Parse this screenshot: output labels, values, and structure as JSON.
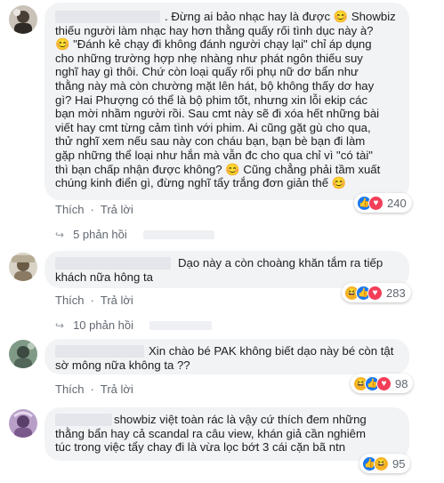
{
  "colors": {
    "like": "#1877f2",
    "love": "#f33e58",
    "haha": "#f7b125",
    "bubble": "#f2f3f5",
    "meta": "#606770"
  },
  "labels": {
    "like": "Thích",
    "reply": "Trả lời",
    "dot": "·"
  },
  "comments": [
    {
      "text": ". Đừng ai bảo nhạc hay là được 😊 Showbiz\nthiếu người làm nhạc hay hơn thằng quấy rối tình dục này à?\n😊 \"Đánh kẻ chạy đi không đánh người chạy lại\" chỉ áp dụng\ncho những trường hợp nhẹ nhàng như phát ngôn thiếu suy\nnghĩ hay gì thôi. Chứ còn loại quấy rối phụ nữ dơ bẩn như\nthằng này mà còn chường mặt lên hát, bộ không thấy dơ hay\ngì? Hai Phượng có thể là bộ phim tốt, nhưng xin lỗi ekip các\nbạn mời nhầm người rồi. Sau cmt này sẽ đi xóa hết những bài\nviết hay cmt từng cảm tình với phim. Ai cũng gặt gù cho qua,\nthử nghĩ xem nếu sau này con cháu bạn, bạn bè bạn đi làm\ngặp những thể loại như hắn mà vẫn đc cho qua chỉ vì \"có tài\"\nthì bạn chấp nhận được không? 😊 Cũng chẳng phải tầm xuất\nchúng kinh điển gì, đừng nghĩ tẩy trắng đơn giản thế 😊",
      "reactions": [
        "like",
        "love"
      ],
      "count": "240",
      "replies_label": "5 phản hồi",
      "avatar_icon": "avatar-icon"
    },
    {
      "text": "Dạo này a còn choàng khăn tắm ra tiếp\nkhách nữa hông ta",
      "reactions": [
        "haha",
        "like",
        "love"
      ],
      "count": "283",
      "replies_label": "10 phản hồi",
      "avatar_icon": "avatar-icon"
    },
    {
      "text": "Xin chào bé PAK không biết dạo này bé còn tật\nsờ mông nữa không ta ??",
      "reactions": [
        "haha",
        "like",
        "love"
      ],
      "count": "98",
      "avatar_icon": "avatar-icon"
    },
    {
      "text": "showbiz việt toàn rác là vậy cứ thích đem những\nthằng bẩn hay cả scandal ra câu view, khán giả cần nghiêm\ntúc trong việc tẩy chay đi là vừa lọc bớt 3 cái cặn bã ntn",
      "reactions": [
        "like",
        "haha"
      ],
      "count": "95",
      "avatar_icon": "avatar-icon"
    }
  ]
}
